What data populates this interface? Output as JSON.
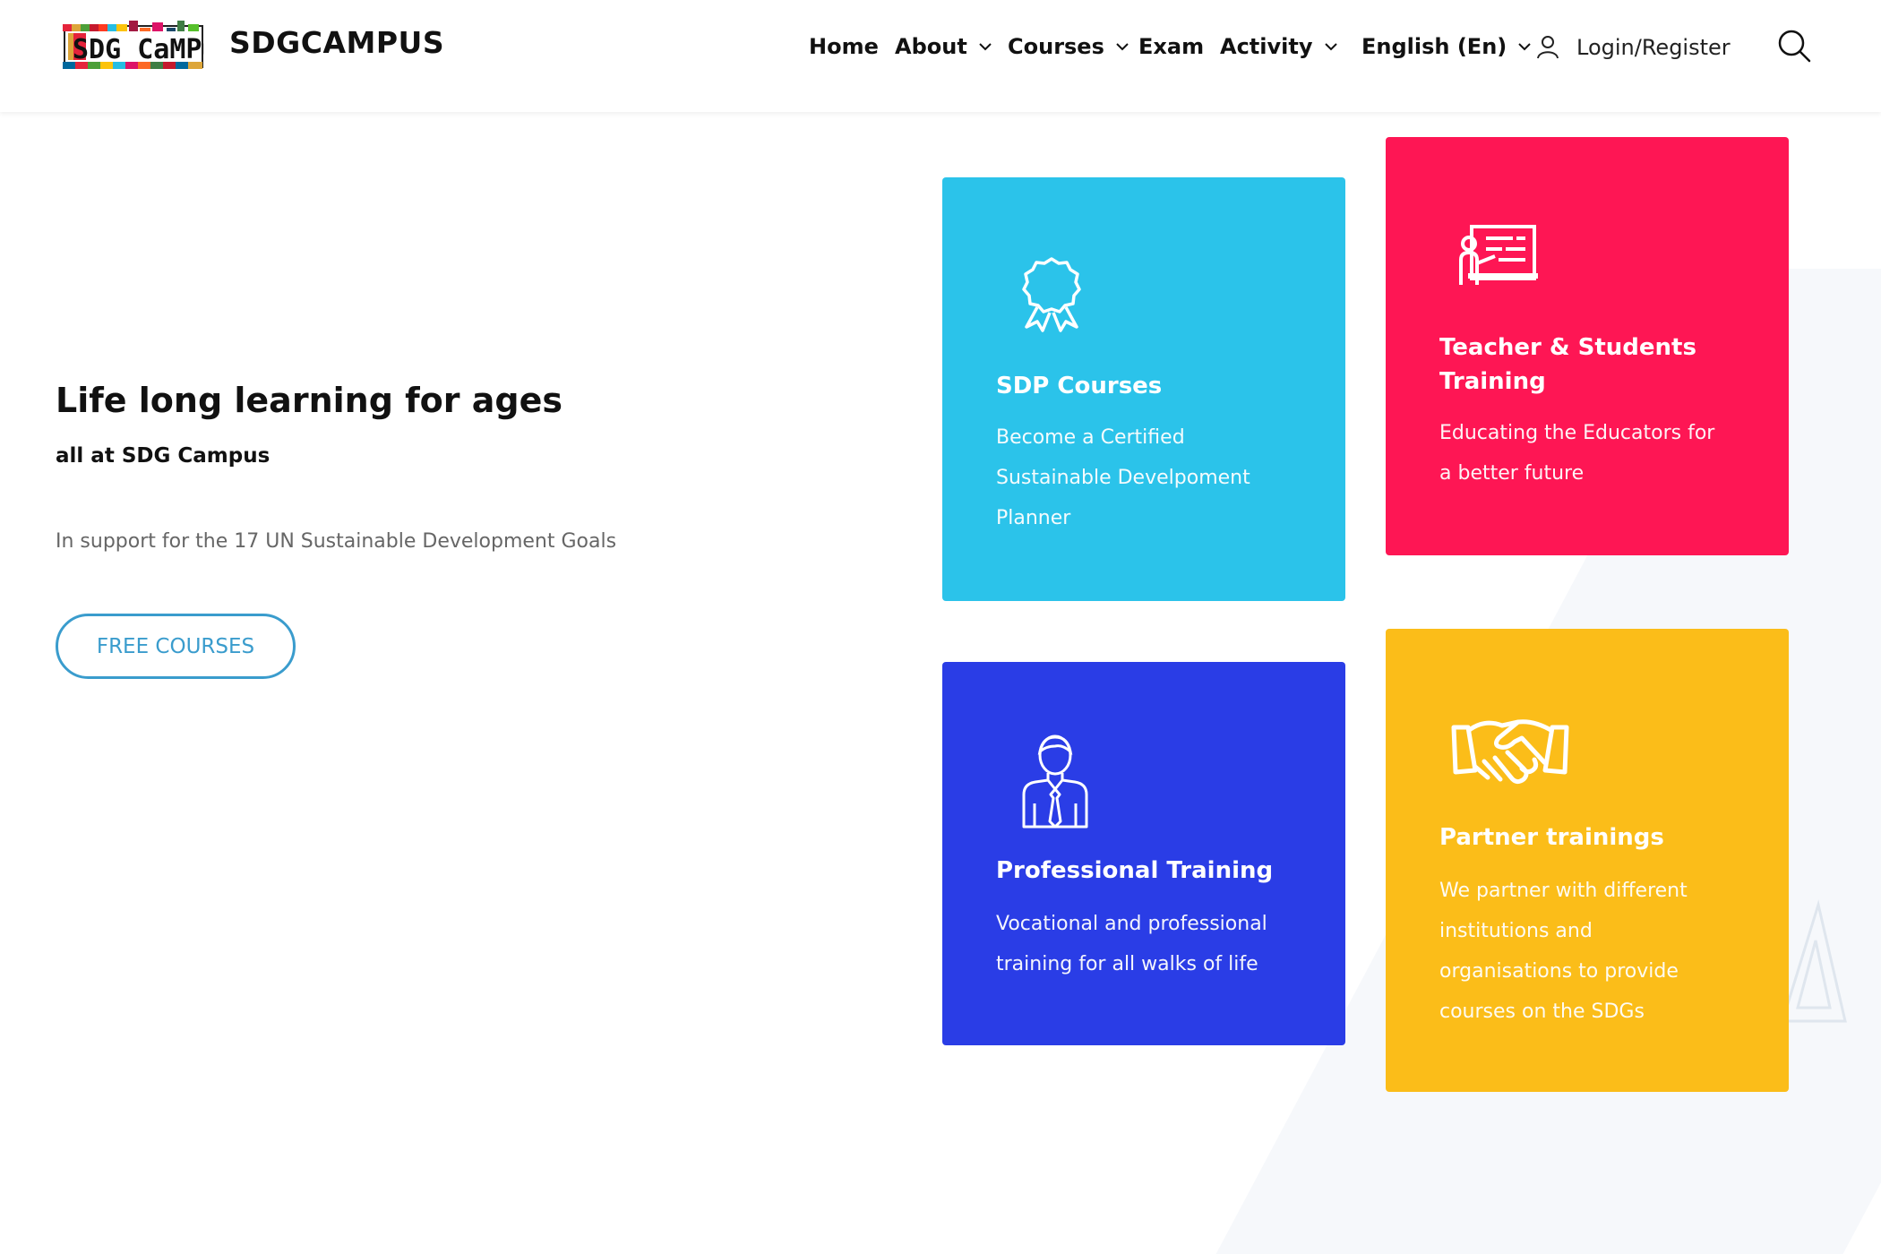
{
  "header": {
    "brand": "SDGCAMPUS",
    "logo_text": "SDG CaMPuS",
    "nav": [
      {
        "label": "Home",
        "has_dropdown": false
      },
      {
        "label": "About",
        "has_dropdown": true
      },
      {
        "label": "Courses",
        "has_dropdown": true
      },
      {
        "label": "Exam",
        "has_dropdown": false
      },
      {
        "label": "Activity",
        "has_dropdown": true
      },
      {
        "label": "English (En)",
        "has_dropdown": true
      }
    ],
    "login_label": "Login/Register"
  },
  "hero": {
    "title": "Life long learning for ages",
    "subtitle": "all at SDG Campus",
    "support": "In support for the 17 UN Sustainable Development Goals",
    "cta_label": "FREE COURSES"
  },
  "cards": [
    {
      "title": "SDP Courses",
      "description": "Become a Certified Sustainable Develpoment Planner",
      "icon": "award-ribbon-icon",
      "color": "#2bc3ea"
    },
    {
      "title": "Teacher & Students Training",
      "description": "Educating the Educators for a better future",
      "icon": "teacher-board-icon",
      "color": "#fe1654"
    },
    {
      "title": "Professional Training",
      "description": "Vocational and professional training for all walks of life",
      "icon": "businessman-icon",
      "color": "#2a3de6"
    },
    {
      "title": "Partner trainings",
      "description": "We partner with different institutions and organisations to provide courses on the SDGs",
      "icon": "handshake-icon",
      "color": "#fbbd19"
    }
  ],
  "colors": {
    "accent": "#3a9ccd",
    "text": "#111111",
    "muted": "#666666"
  }
}
